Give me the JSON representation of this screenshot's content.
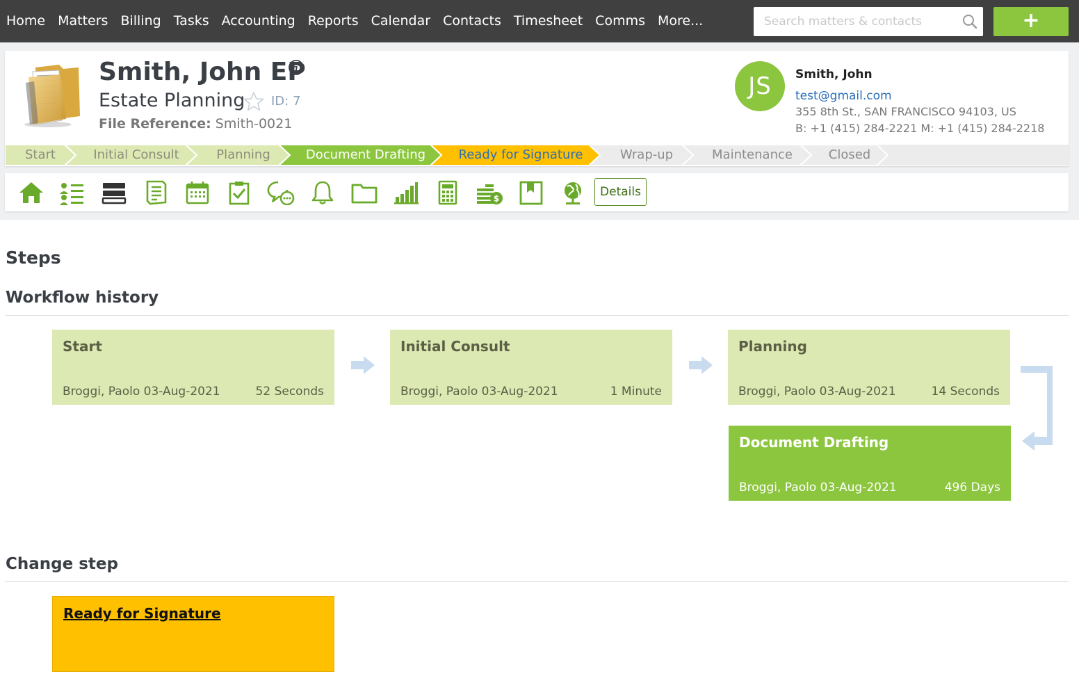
{
  "nav": {
    "items": [
      "Home",
      "Matters",
      "Billing",
      "Tasks",
      "Accounting",
      "Reports",
      "Calendar",
      "Contacts",
      "Timesheet",
      "Comms",
      "More..."
    ],
    "search_placeholder": "Search matters & contacts",
    "add_label": "+"
  },
  "matter": {
    "title": "Smith, John EP",
    "subtitle": "Estate Planning",
    "id_label": "ID: 7",
    "file_ref_label": "File Reference:",
    "file_ref_value": "Smith-0021"
  },
  "contact": {
    "initials": "JS",
    "name": "Smith, John",
    "email": "test@gmail.com",
    "address": "355 8th St., SAN FRANCISCO 94103, US",
    "phones": "B: +1 (415) 284-2221  M: +1 (415) 284-2218"
  },
  "stages": [
    {
      "label": "Start",
      "state": "done"
    },
    {
      "label": "Initial Consult",
      "state": "done"
    },
    {
      "label": "Planning",
      "state": "done"
    },
    {
      "label": "Document Drafting",
      "state": "current"
    },
    {
      "label": "Ready for Signature",
      "state": "next"
    },
    {
      "label": "Wrap-up",
      "state": "future"
    },
    {
      "label": "Maintenance",
      "state": "future"
    },
    {
      "label": "Closed",
      "state": "future"
    }
  ],
  "toolbar": {
    "icons": [
      "home-icon",
      "contacts-list-icon",
      "card-stack-icon",
      "notes-icon",
      "calendar-icon",
      "task-check-icon",
      "chat-icon",
      "bell-icon",
      "folder-icon",
      "bar-chart-icon",
      "calculator-icon",
      "coins-icon",
      "bookmark-icon",
      "globe-icon"
    ],
    "details_label": "Details"
  },
  "sections": {
    "steps": "Steps",
    "workflow_history": "Workflow history",
    "change_step": "Change step"
  },
  "workflow_history": [
    {
      "step": "Start",
      "by": "Broggi, Paolo 03-Aug-2021",
      "duration": "52 Seconds"
    },
    {
      "step": "Initial Consult",
      "by": "Broggi, Paolo 03-Aug-2021",
      "duration": "1 Minute"
    },
    {
      "step": "Planning",
      "by": "Broggi, Paolo 03-Aug-2021",
      "duration": "14 Seconds"
    },
    {
      "step": "Document Drafting",
      "by": "Broggi, Paolo 03-Aug-2021",
      "duration": "496 Days"
    }
  ],
  "change_step": {
    "option": "Ready for Signature"
  },
  "colors": {
    "nav_bg": "#404040",
    "brand_green": "#8cc63f",
    "done_stage_bg": "#dde9b3",
    "done_stage_text": "#8c8c7a",
    "next_stage_bg": "#ffc000",
    "next_stage_text": "#2a6eb8",
    "future_stage_bg": "#ececec",
    "arrow": "#c9dcef"
  }
}
